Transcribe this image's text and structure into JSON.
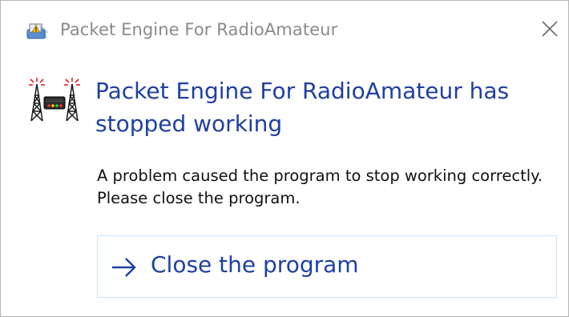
{
  "window": {
    "title": "Packet Engine For RadioAmateur",
    "title_icon": "windows-error-reporting-icon",
    "close_icon": "close-icon"
  },
  "main": {
    "app_icon": "radio-tower-icon",
    "heading": "Packet Engine For RadioAmateur has stopped working",
    "message": "A problem caused the program to stop working correctly. Please close the program."
  },
  "actions": {
    "close_program": {
      "label": "Close the program",
      "icon": "arrow-right-icon"
    }
  },
  "colors": {
    "heading": "#1f3fa3",
    "title_text": "#8a8a8a",
    "button_border": "#c9e3f3"
  }
}
